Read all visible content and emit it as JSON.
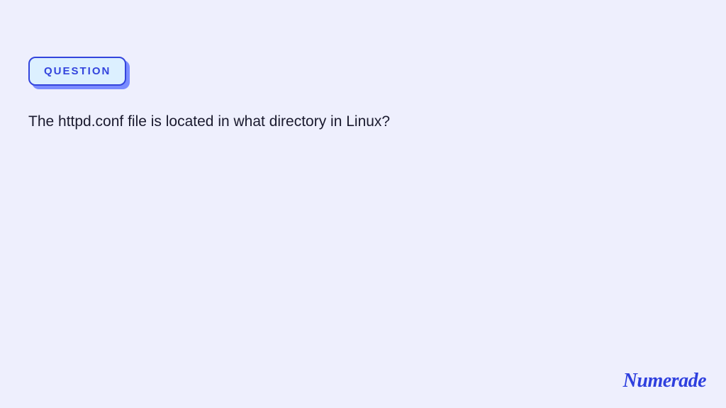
{
  "badge": {
    "label": "QUESTION"
  },
  "question": {
    "text": "The httpd.conf file is located in what directory in Linux?"
  },
  "brand": {
    "name": "Numerade"
  }
}
